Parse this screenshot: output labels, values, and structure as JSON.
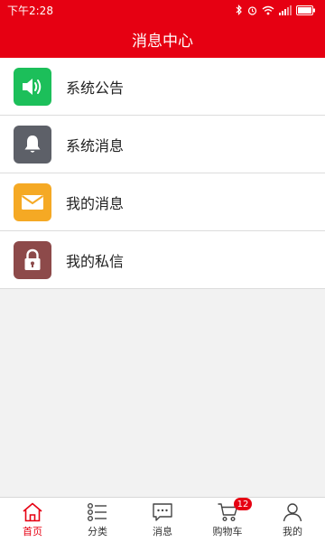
{
  "status_bar": {
    "time": "下午2:28"
  },
  "header": {
    "title": "消息中心"
  },
  "list": [
    {
      "label": "系统公告",
      "icon": "speaker-icon",
      "color": "#1cbf5a"
    },
    {
      "label": "系统消息",
      "icon": "bell-icon",
      "color": "#5d6068"
    },
    {
      "label": "我的消息",
      "icon": "envelope-icon",
      "color": "#f5a924"
    },
    {
      "label": "我的私信",
      "icon": "lock-icon",
      "color": "#8d4a4a"
    }
  ],
  "tabbar": {
    "items": [
      {
        "label": "首页",
        "icon": "home-icon",
        "active": true
      },
      {
        "label": "分类",
        "icon": "category-icon"
      },
      {
        "label": "消息",
        "icon": "message-icon"
      },
      {
        "label": "购物车",
        "icon": "cart-icon",
        "badge": "12"
      },
      {
        "label": "我的",
        "icon": "user-icon"
      }
    ]
  },
  "colors": {
    "brand": "#e60012"
  }
}
